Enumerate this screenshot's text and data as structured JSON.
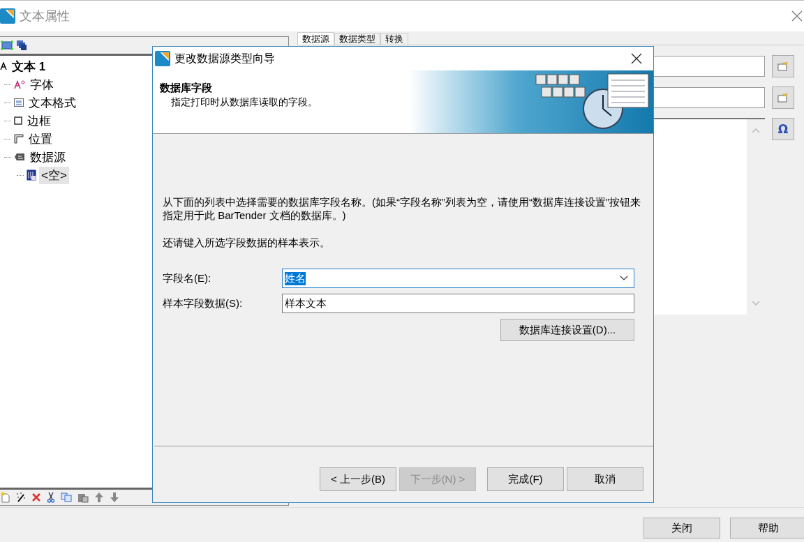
{
  "window": {
    "title": "文本属性"
  },
  "tree": [
    {
      "label": "文本 1",
      "selected": false,
      "children": [
        {
          "label": "字体",
          "selected": false
        },
        {
          "label": "文本格式",
          "selected": false
        },
        {
          "label": "边框",
          "selected": false
        },
        {
          "label": "位置",
          "selected": false
        },
        {
          "label": "数据源",
          "selected": false,
          "children": [
            {
              "label": "<空>",
              "selected": true
            }
          ]
        }
      ]
    }
  ],
  "tabs": [
    {
      "label": "数据源",
      "selected": true
    },
    {
      "label": "数据类型",
      "selected": false
    },
    {
      "label": "转换",
      "selected": false
    }
  ],
  "right_panel": {
    "symbol_button": "Ω"
  },
  "footer_buttons": [
    "关闭",
    "帮助"
  ],
  "dialog": {
    "title": "更改数据源类型向导",
    "heading": "数据库字段",
    "subheading": "指定打印时从数据库读取的字段。",
    "instructions": "从下面的列表中选择需要的数据库字段名称。(如果“字段名称”列表为空，请使用“数据库连接设置”按钮来指定用于此 BarTender 文档的数据库。)",
    "hint": "还请键入所选字段数据的样本表示。",
    "fields": [
      {
        "kind": "dropdown",
        "label": "字段名(E):",
        "value": "姓名"
      },
      {
        "kind": "text",
        "label": "样本字段数据(S):",
        "value": "样本文本"
      }
    ],
    "connection_button": "数据库连接设置(D)...",
    "buttons": [
      {
        "label": "< 上一步(B)",
        "disabled": false
      },
      {
        "label": "下一步(N) >",
        "disabled": true
      },
      {
        "label": "完成(F)",
        "disabled": false
      },
      {
        "label": "取消",
        "disabled": false
      }
    ]
  }
}
